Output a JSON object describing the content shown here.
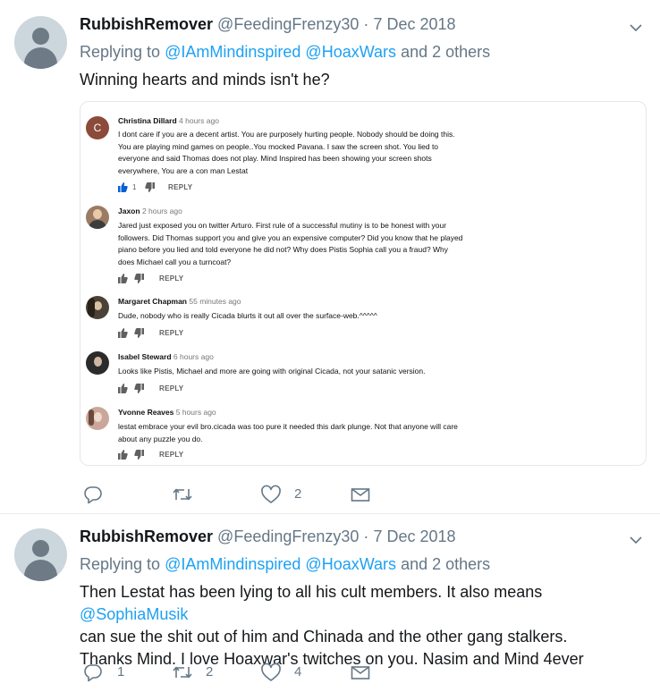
{
  "tweets": [
    {
      "name": "RubbishRemover",
      "handle": "@FeedingFrenzy30",
      "dot": "·",
      "date": "7 Dec 2018",
      "replying_prefix": "Replying to",
      "mention1": "@IAmMindinspired",
      "mention2": "@HoaxWars",
      "replying_suffix": "and 2 others",
      "text": "Winning hearts and minds isn't he?",
      "reply_count": "",
      "retweet_count": "",
      "like_count": "2"
    },
    {
      "name": "RubbishRemover",
      "handle": "@FeedingFrenzy30",
      "dot": "·",
      "date": "7 Dec 2018",
      "replying_prefix": "Replying to",
      "mention1": "@IAmMindinspired",
      "mention2": "@HoaxWars",
      "replying_suffix": "and 2 others",
      "text_line1_pre": "Then Lestat has been lying to all his cult members. It also means ",
      "text_line1_mention": "@SophiaMusik",
      "text_line2": "can sue the shit out of him and Chinada and the other gang stalkers.",
      "text_line3": "Thanks Mind.  I love Hoaxwar's twitches on you. Nasim and Mind 4ever",
      "reply_count": "1",
      "retweet_count": "2",
      "like_count": "4"
    }
  ],
  "embed": {
    "reply_label": "REPLY",
    "comments": [
      {
        "author": "Christina Dillard",
        "time": "4 hours ago",
        "avatar_letter": "C",
        "avatar_color": "#8b4a3a",
        "lines": [
          "I dont care if you are a decent artist. You are purposely hurting people. Nobody should be doing this.",
          "You are playing mind games on people..You mocked Pavana. I saw the screen shot. You lied to",
          "everyone and said Thomas does not play. Mind Inspired has been showing your screen shots",
          "everywhere, You are a con man Lestat"
        ],
        "likes": "1"
      },
      {
        "author": "Jaxon",
        "time": "2 hours ago",
        "avatar_color": "#9b7b63",
        "lines": [
          "Jared just exposed you on twitter Arturo. First rule of a successful mutiny is to be honest with your",
          "followers. Did Thomas support you and give you an expensive computer? Did you know that he played",
          "piano before you lied and told everyone he did not? Why does Pistis Sophia call you a fraud? Why",
          "does Michael call you a turncoat?"
        ],
        "likes": ""
      },
      {
        "author": "Margaret Chapman",
        "time": "55 minutes ago",
        "avatar_color": "#4a4236",
        "lines": [
          "Dude, nobody who is really Cicada blurts it out all over the surface-web.^^^^^"
        ],
        "likes": ""
      },
      {
        "author": "Isabel Steward",
        "time": "6 hours ago",
        "avatar_color": "#2b2b2b",
        "lines": [
          "Looks like Pistis, Michael and more are going with original Cicada, not your satanic version."
        ],
        "likes": ""
      },
      {
        "author": "Yvonne Reaves",
        "time": "5 hours ago",
        "avatar_color": "#c9a79a",
        "lines": [
          "lestat embrace your evil bro.cicada was too pure it needed this dark plunge. Not that anyone will care",
          "about any puzzle you do."
        ],
        "likes": ""
      }
    ]
  },
  "colors": {
    "accent": "#1da1f2",
    "muted": "#657786",
    "like_blue": "#065fd4"
  },
  "icons": [
    "chevron-down-icon",
    "reply-icon",
    "retweet-icon",
    "heart-icon",
    "envelope-icon",
    "thumbs-up-icon",
    "thumbs-down-icon"
  ]
}
